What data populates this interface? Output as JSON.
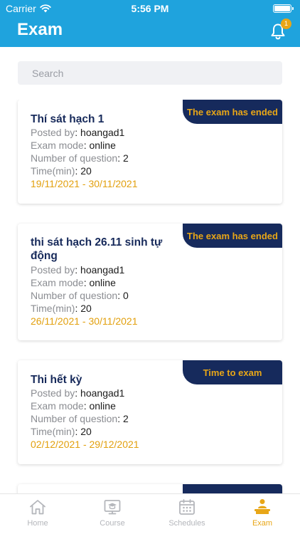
{
  "status_bar": {
    "carrier": "Carrier",
    "time": "5:56 PM"
  },
  "header": {
    "title": "Exam",
    "notification_count": "1"
  },
  "search": {
    "placeholder": "Search"
  },
  "labels": {
    "posted_by": "Posted by",
    "exam_mode": "Exam mode",
    "num_questions": "Number of question",
    "time_min": "Time(min)"
  },
  "exams": [
    {
      "name": "Thí sát hạch 1",
      "status": "The exam has ended",
      "posted_by": "hoangad1",
      "exam_mode": "online",
      "num_questions": "2",
      "time_min": "20",
      "dates": "19/11/2021 - 30/11/2021"
    },
    {
      "name": "thi sát hạch 26.11  sinh tự động",
      "status": "The exam has ended",
      "posted_by": "hoangad1",
      "exam_mode": "online",
      "num_questions": "0",
      "time_min": "20",
      "dates": "26/11/2021 - 30/11/2021"
    },
    {
      "name": "Thi hết kỳ",
      "status": "Time to exam",
      "posted_by": "hoangad1",
      "exam_mode": "online",
      "num_questions": "2",
      "time_min": "20",
      "dates": "02/12/2021 - 29/12/2021"
    }
  ],
  "tabs": [
    {
      "label": "Home",
      "icon": "home-icon"
    },
    {
      "label": "Course",
      "icon": "course-icon"
    },
    {
      "label": "Schedules",
      "icon": "calendar-icon"
    },
    {
      "label": "Exam",
      "icon": "exam-icon",
      "active": true
    }
  ],
  "colors": {
    "header": "#1fa3dd",
    "tag_bg": "#162a5c",
    "accent": "#e8a617",
    "title_text": "#16295a"
  }
}
